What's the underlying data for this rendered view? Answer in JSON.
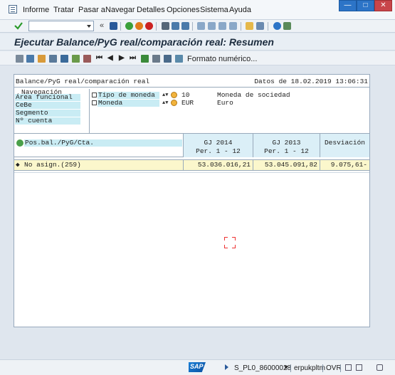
{
  "menu": {
    "items": [
      {
        "label": "Informe",
        "icon": "system-menu-icon"
      },
      {
        "label": "Tratar"
      },
      {
        "label": "Pasar a"
      },
      {
        "label": "Navegar"
      },
      {
        "label": "Detalles"
      },
      {
        "label": "Opciones"
      },
      {
        "label": "Sistema"
      },
      {
        "label": "Ayuda"
      }
    ],
    "window_controls": {
      "restore": "□",
      "minimize": "—",
      "close": "✕"
    }
  },
  "toolbar": {
    "command_value": "",
    "chevron": "«",
    "colors": {
      "save": "#2a5a9a",
      "back": "#3aa03a",
      "exit": "#e07a1a",
      "cancel": "#cc2222",
      "help": "#2c74c7"
    }
  },
  "title": "Ejecutar Balance/PyG real/comparación real: Resumen",
  "app_toolbar": {
    "formato_label": "Formato numérico...",
    "nav": [
      "⏮",
      "◀",
      "▶",
      "⏭"
    ]
  },
  "report": {
    "header_left": "Balance/PyG real/comparación real",
    "header_right": "Datos de 18.02.2019 13:06:31",
    "navigation": {
      "caption": "Navegación",
      "items": [
        "Área funcional",
        "CeBe",
        "Segmento",
        "Nº cuenta"
      ]
    },
    "settings": [
      {
        "label": "Tipo de moneda",
        "value": "10",
        "description": "Moneda de sociedad"
      },
      {
        "label": "Moneda",
        "value": "EUR",
        "description": "Euro"
      }
    ],
    "table": {
      "position_header": "Pos.bal./PyG/Cta.",
      "columns": [
        {
          "title": "GJ 2014",
          "sub": "Per.   1 -  12"
        },
        {
          "title": "GJ 2013",
          "sub": "Per.   1 -  12"
        },
        {
          "title": "Desviación",
          "sub": ""
        }
      ],
      "rows": [
        {
          "label": "No asign.(259)",
          "values": [
            "53.036.016,21",
            "53.045.091,82",
            "9.075,61-"
          ]
        }
      ]
    }
  },
  "status": {
    "system": "S_PL0_86000028",
    "user": "erpukpltm",
    "mode": "OVR"
  }
}
